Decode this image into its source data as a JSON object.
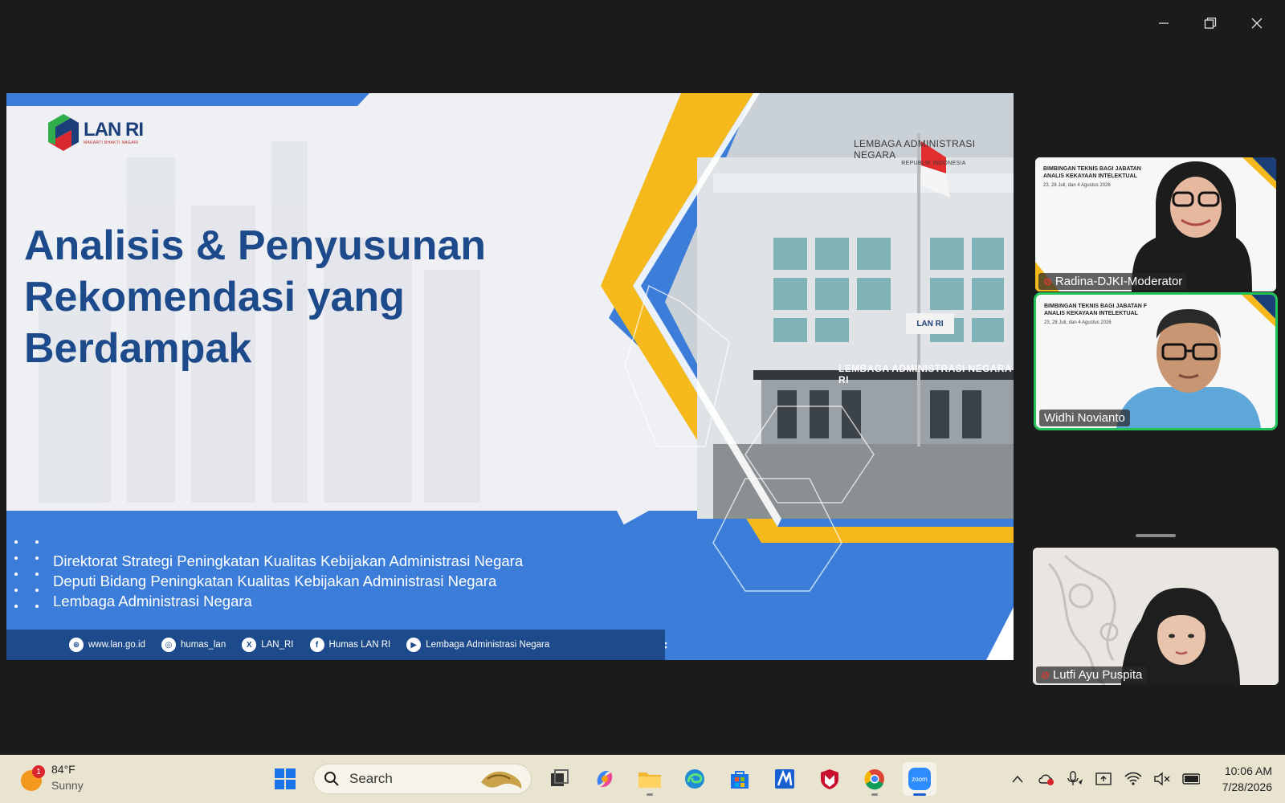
{
  "window": {
    "controls": [
      "minimize",
      "restore",
      "close"
    ]
  },
  "slide": {
    "logo_main": "LAN RI",
    "logo_sub": "MAKARTI BHAKTI NAGARI",
    "title_lines": [
      "Analisis & Penyusunan",
      "Rekomendasi yang",
      "Berdampak"
    ],
    "building_top_sign": "LEMBAGA ADMINISTRASI NEGARA",
    "building_top_sign_sub": "REPUBLIK INDONESIA",
    "building_front_sign": "LEMBAGA ADMINISTRASI NEGARA RI",
    "building_logo": "LAN RI",
    "subtitles": [
      "Direktorat Strategi Peningkatan Kualitas Kebijakan Administrasi Negara",
      "Deputi Bidang Peningkatan Kualitas Kebijakan Administrasi Negara",
      "Lembaga Administrasi Negara"
    ],
    "socials": [
      {
        "icon": "globe-icon",
        "glyph": "⊕",
        "label": "www.lan.go.id"
      },
      {
        "icon": "instagram-icon",
        "glyph": "◎",
        "label": "humas_lan"
      },
      {
        "icon": "x-icon",
        "glyph": "X",
        "label": "LAN_RI"
      },
      {
        "icon": "facebook-icon",
        "glyph": "f",
        "label": "Humas LAN RI"
      },
      {
        "icon": "youtube-icon",
        "glyph": "▶",
        "label": "Lembaga Administrasi Negara"
      }
    ]
  },
  "participants": [
    {
      "name": "Radina-DJKI-Moderator",
      "muted": true,
      "thumb_lines": [
        "BIMBINGAN TEKNIS BAGI JABATAN",
        "ANALIS KEKAYAAN INTELEKTUAL"
      ],
      "thumb_date": "23, 28 Juli, dan 4 Agustus 2026"
    },
    {
      "name": "Widhi Novianto",
      "muted": false,
      "thumb_lines": [
        "BIMBINGAN TEKNIS BAGI JABATAN F",
        "ANALIS KEKAYAAN INTELEKTUAL"
      ],
      "thumb_date": "23, 28 Juli, dan 4 Agustus 2026"
    },
    {
      "name": "Lutfi Ayu Puspita",
      "muted": true
    }
  ],
  "taskbar": {
    "weather": {
      "temp": "84°F",
      "condition": "Sunny",
      "badge": "1"
    },
    "search_placeholder": "Search",
    "clock": {
      "time": "10:06 AM",
      "date": "7/28/2026"
    },
    "colors": {
      "active_indicator": "#1a5fd1",
      "zoom": "#2d8cff"
    }
  },
  "colors": {
    "slide_blue": "#3b7dd8",
    "slide_navy": "#1c4a8a",
    "slide_yellow": "#f5b91c",
    "active_speaker": "#24c45a"
  }
}
